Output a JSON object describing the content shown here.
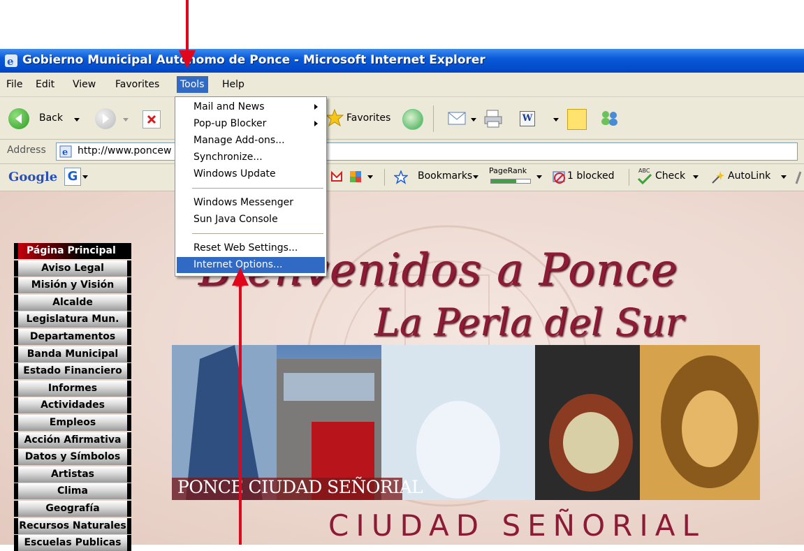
{
  "window": {
    "title": "Gobierno Municipal Autónomo de Ponce - Microsoft Internet Explorer"
  },
  "menubar": {
    "items": [
      "File",
      "Edit",
      "View",
      "Favorites",
      "Tools",
      "Help"
    ],
    "active": "Tools"
  },
  "toolbar": {
    "back_label": "Back",
    "favorites_label": "Favorites"
  },
  "address": {
    "label": "Address",
    "url": "http://www.poncew"
  },
  "google_toolbar": {
    "logo": "Google",
    "g_button": "G",
    "bookmarks_label": "Bookmarks",
    "pagerank_label": "PageRank",
    "blocked_label": "1 blocked",
    "check_label": "Check",
    "autolink_label": "AutoLink",
    "abc_badge": "ABC"
  },
  "tools_menu": {
    "items": [
      {
        "label": "Mail and News",
        "submenu": true
      },
      {
        "label": "Pop-up Blocker",
        "submenu": true
      },
      {
        "label": "Manage Add-ons...",
        "submenu": false
      },
      {
        "label": "Synchronize...",
        "submenu": false
      },
      {
        "label": "Windows Update",
        "submenu": false
      },
      {
        "label": "Windows Messenger",
        "submenu": false
      },
      {
        "label": "Sun Java Console",
        "submenu": false
      },
      {
        "label": "Reset Web Settings...",
        "submenu": false
      },
      {
        "label": "Internet Options...",
        "submenu": false,
        "highlighted": true
      }
    ]
  },
  "page": {
    "nav": [
      "Página Principal",
      "Aviso Legal",
      "Misión y Visión",
      "Alcalde",
      "Legislatura Mun.",
      "Departamentos",
      "Banda Municipal",
      "Estado Financiero",
      "Informes",
      "Actividades",
      "Empleos",
      "Acción Afirmativa",
      "Datos y Símbolos",
      "Artistas",
      "Clima",
      "Geografía",
      "Recursos Naturales",
      "Escuelas Publicas"
    ],
    "heading": "Bienvenidos a Ponce",
    "subheading": "La Perla del Sur",
    "banner_caption": "PONCE CIUDAD SEÑORIAL",
    "footer_heading": "CIUDAD SEÑORIAL"
  },
  "colors": {
    "accent_red": "#e0061c",
    "title_blue": "#0a5ad8",
    "menu_highlight": "#316ac5",
    "page_heading": "#8c1b35"
  }
}
